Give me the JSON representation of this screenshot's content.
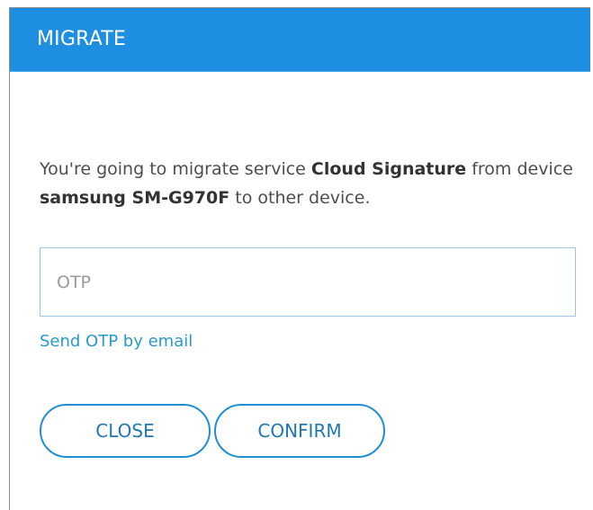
{
  "dialog": {
    "title": "MIGRATE",
    "message": {
      "part1": "You're going to migrate service ",
      "service": "Cloud Signature",
      "part2": " from device ",
      "device": "samsung SM-G970F",
      "part3": " to other device."
    },
    "otp": {
      "placeholder": "OTP",
      "value": ""
    },
    "send_otp_label": "Send OTP by email",
    "buttons": {
      "close": "CLOSE",
      "confirm": "CONFIRM"
    }
  },
  "colors": {
    "header_bg": "#1e8fe0",
    "accent": "#1f8fd2",
    "link": "#2a9ac9"
  }
}
